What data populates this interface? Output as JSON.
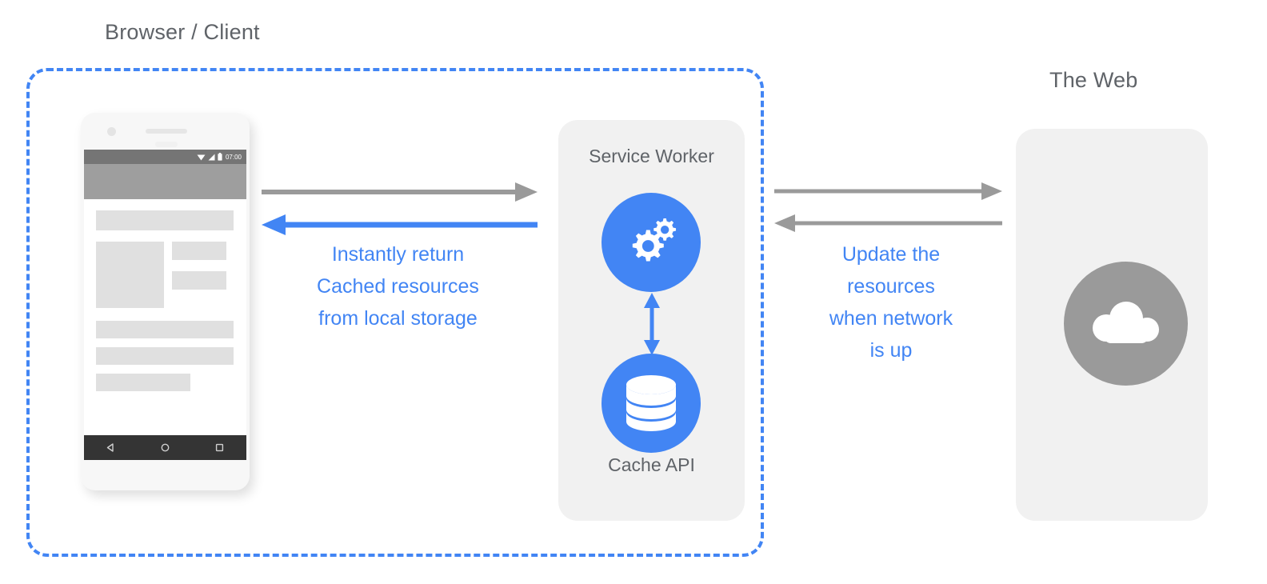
{
  "diagram": {
    "title_browser_client": "Browser / Client",
    "title_the_web": "The Web",
    "service_worker_label": "Service Worker",
    "cache_api_label": "Cache API",
    "annotation_left": "Instantly return\nCached resources\nfrom local storage",
    "annotation_right": "Update the\nresources\nwhen network\nis up",
    "colors": {
      "accent_blue": "#4285f4",
      "arrow_gray": "#9a9a9a",
      "panel_gray": "#f1f1f1",
      "text_gray": "#5f6368",
      "web_circle_gray": "#9a9a9a"
    },
    "icons": {
      "service_worker": "gears-icon",
      "cache_api": "database-icon",
      "the_web": "cloud-icon"
    }
  },
  "phone": {
    "status_bar": {
      "clock": "07:00",
      "icons": [
        "wifi-icon",
        "signal-icon",
        "battery-icon"
      ]
    },
    "nav_bar": {
      "buttons": [
        "back-triangle-icon",
        "home-circle-icon",
        "recents-square-icon"
      ]
    }
  }
}
